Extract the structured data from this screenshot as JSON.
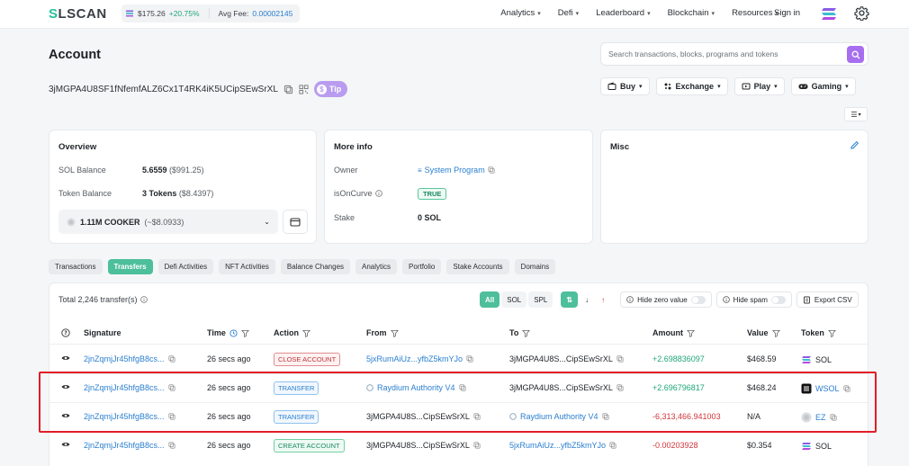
{
  "nav": {
    "logo_pre": "S",
    "logo_post": "LSCAN",
    "sol_price": "$175.26",
    "sol_change": "+20.75%",
    "fee_label": "Avg Fee:",
    "fee_value": "0.00002145",
    "links": [
      "Analytics",
      "Defi",
      "Leaderboard",
      "Blockchain",
      "Resources"
    ],
    "signin": "Sign in"
  },
  "account": {
    "title": "Account",
    "address": "3jMGPA4U8SF1fNfemfALZ6Cx1T4RK4iK5UCipSEwSrXL",
    "tip_label": "Tip"
  },
  "search": {
    "placeholder": "Search transactions, blocks, programs and tokens"
  },
  "actions": [
    "Buy",
    "Exchange",
    "Play",
    "Gaming"
  ],
  "overview": {
    "title": "Overview",
    "sol_balance_label": "SOL Balance",
    "sol_balance": "5.6559",
    "sol_balance_usd": "($991.25)",
    "token_balance_label": "Token Balance",
    "token_balance": "3 Tokens",
    "token_balance_usd": "($8.4397)",
    "token_select": "1.11M COOKER",
    "token_select_usd": "(~$8.0933)"
  },
  "moreinfo": {
    "title": "More info",
    "owner_label": "Owner",
    "owner_value": "System Program",
    "curve_label": "isOnCurve",
    "curve_value": "TRUE",
    "stake_label": "Stake",
    "stake_value": "0 SOL"
  },
  "misc": {
    "title": "Misc"
  },
  "tabs": [
    "Transactions",
    "Transfers",
    "Defi Activities",
    "NFT Activities",
    "Balance Changes",
    "Analytics",
    "Portfolio",
    "Stake Accounts",
    "Domains"
  ],
  "transfers": {
    "total": "Total 2,246 transfer(s)",
    "filters": [
      "All",
      "SOL",
      "SPL"
    ],
    "hide_zero": "Hide zero value",
    "hide_spam": "Hide spam",
    "export": "Export CSV",
    "columns": [
      "Signature",
      "Time",
      "Action",
      "From",
      "To",
      "Amount",
      "Value",
      "Token"
    ],
    "rows": [
      {
        "signature": "2jnZqmjJr45hfgB8cs...",
        "time": "26 secs ago",
        "action": "CLOSE ACCOUNT",
        "from": "5jxRumAiUz...yfbZ5kmYJo",
        "to": "3jMGPA4U8S...CipSEwSrXL",
        "amount": "+2.698836097",
        "value": "$468.59",
        "token": "SOL"
      },
      {
        "signature": "2jnZqmjJr45hfgB8cs...",
        "time": "26 secs ago",
        "action": "TRANSFER",
        "from": "Raydium Authority V4",
        "to": "3jMGPA4U8S...CipSEwSrXL",
        "amount": "+2.696796817",
        "value": "$468.24",
        "token": "WSOL"
      },
      {
        "signature": "2jnZqmjJr45hfgB8cs...",
        "time": "26 secs ago",
        "action": "TRANSFER",
        "from": "3jMGPA4U8S...CipSEwSrXL",
        "to": "Raydium Authority V4",
        "amount": "-6,313,466.941003",
        "value": "N/A",
        "token": "EZ"
      },
      {
        "signature": "2jnZqmjJr45hfgB8cs...",
        "time": "26 secs ago",
        "action": "CREATE ACCOUNT",
        "from": "3jMGPA4U8S...CipSEwSrXL",
        "to": "5jxRumAiUz...yfbZ5kmYJo",
        "amount": "-0.00203928",
        "value": "$0.354",
        "token": "SOL"
      }
    ]
  },
  "colors": {
    "accent": "#4dbf9a",
    "link": "#2a7fd0",
    "positive": "#1fa67a",
    "negative": "#d1363a",
    "highlight": "#e01e27"
  }
}
